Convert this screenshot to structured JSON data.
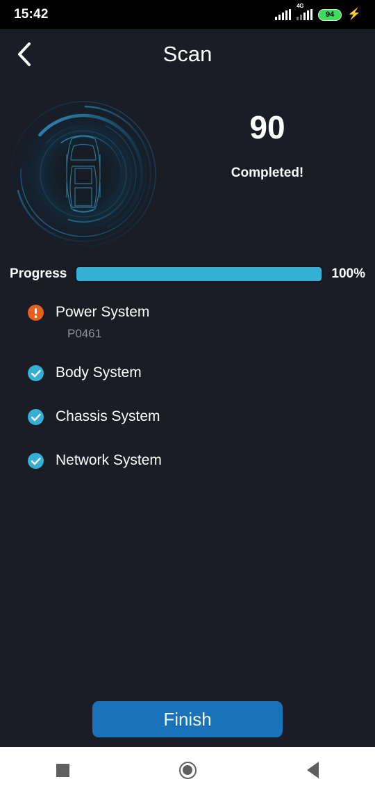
{
  "status_bar": {
    "time": "15:42",
    "network_label": "4G",
    "battery_percent": "94",
    "icons": {
      "signal": "signal-bars-icon",
      "signal_secondary": "signal-bars-4g-icon",
      "battery": "battery-icon",
      "charging": "charging-bolt-icon"
    }
  },
  "app_bar": {
    "back_icon": "chevron-left-icon",
    "title": "Scan"
  },
  "hero": {
    "radar_icon": "radar-car-scan-icon",
    "count": "90",
    "status_text": "Completed!"
  },
  "progress": {
    "label": "Progress",
    "percent_text": "100%",
    "percent_value": 100,
    "fill_color": "#35afd4"
  },
  "systems": [
    {
      "label": "Power System",
      "icon": "warning-circle-icon",
      "status": "fault",
      "code": "P0461"
    },
    {
      "label": "Body System",
      "icon": "check-circle-icon",
      "status": "ok",
      "code": ""
    },
    {
      "label": "Chassis System",
      "icon": "check-circle-icon",
      "status": "ok",
      "code": ""
    },
    {
      "label": "Network System",
      "icon": "check-circle-icon",
      "status": "ok",
      "code": ""
    }
  ],
  "footer": {
    "finish_label": "Finish"
  },
  "nav_bar": {
    "recents_icon": "square-recents-icon",
    "home_icon": "circle-home-icon",
    "back_icon": "triangle-back-icon"
  },
  "colors": {
    "background": "#1a1d26",
    "accent": "#35afd4",
    "warning": "#e8601f",
    "button": "#1a72b8",
    "battery_green": "#3ddc5b"
  }
}
